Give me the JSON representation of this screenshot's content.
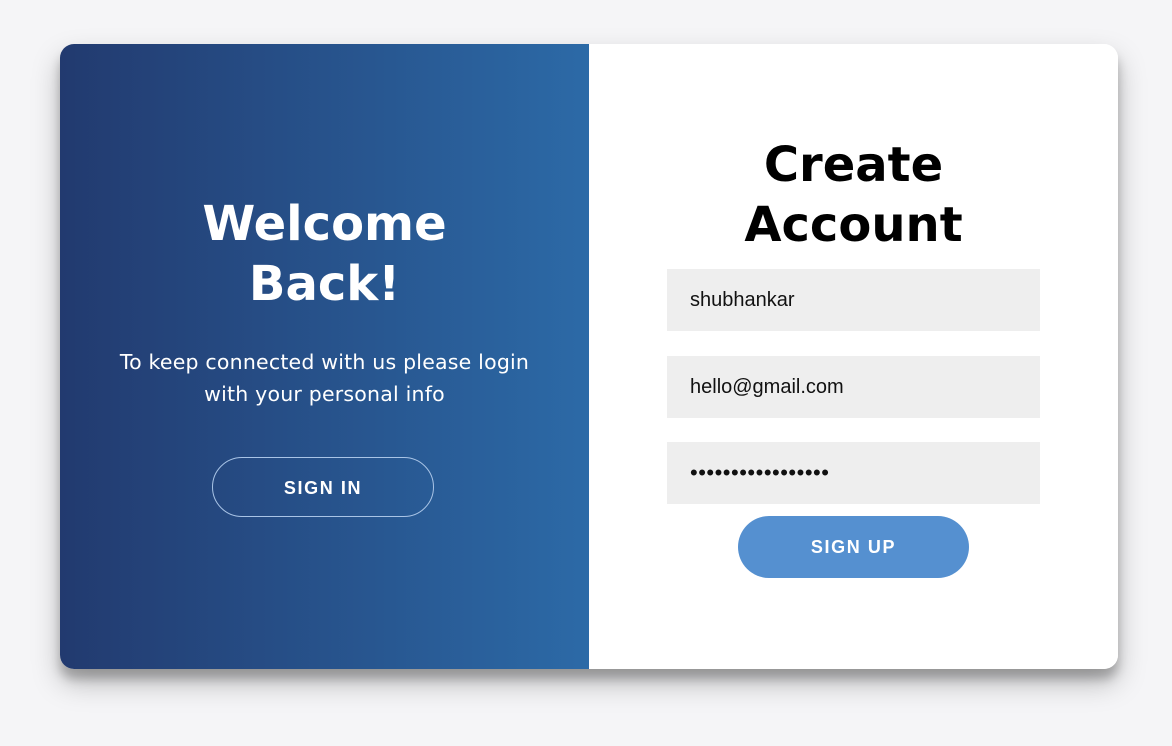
{
  "overlay_panel": {
    "title_line1": "Welcome",
    "title_line2": "Back!",
    "message": "To keep connected with us please login with your personal info",
    "sign_in_label": "SIGN IN"
  },
  "signup_form": {
    "title_line1": "Create",
    "title_line2": "Account",
    "name_value": "shubhankar",
    "email_value": "hello@gmail.com",
    "password_value": "•••••••••••••••••",
    "sign_up_label": "SIGN UP"
  },
  "colors": {
    "gradient_start": "#223a6f",
    "gradient_end": "#2c6aa7",
    "primary_button": "#5590d0",
    "input_background": "#eeeeee",
    "page_background": "#f5f5f7"
  }
}
